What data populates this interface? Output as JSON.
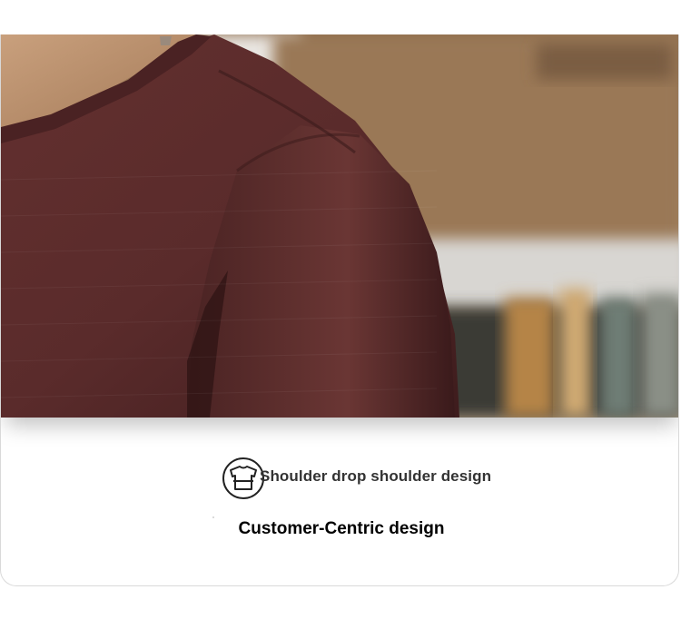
{
  "feature": {
    "icon": "shoulder-shirt-icon",
    "label": "Shoulder drop shoulder design"
  },
  "tagline": "Customer-Centric design",
  "colors": {
    "shirt": "#5a2c2c",
    "background_wall": "#a88764",
    "text_primary": "#000000",
    "text_secondary": "#333333"
  }
}
